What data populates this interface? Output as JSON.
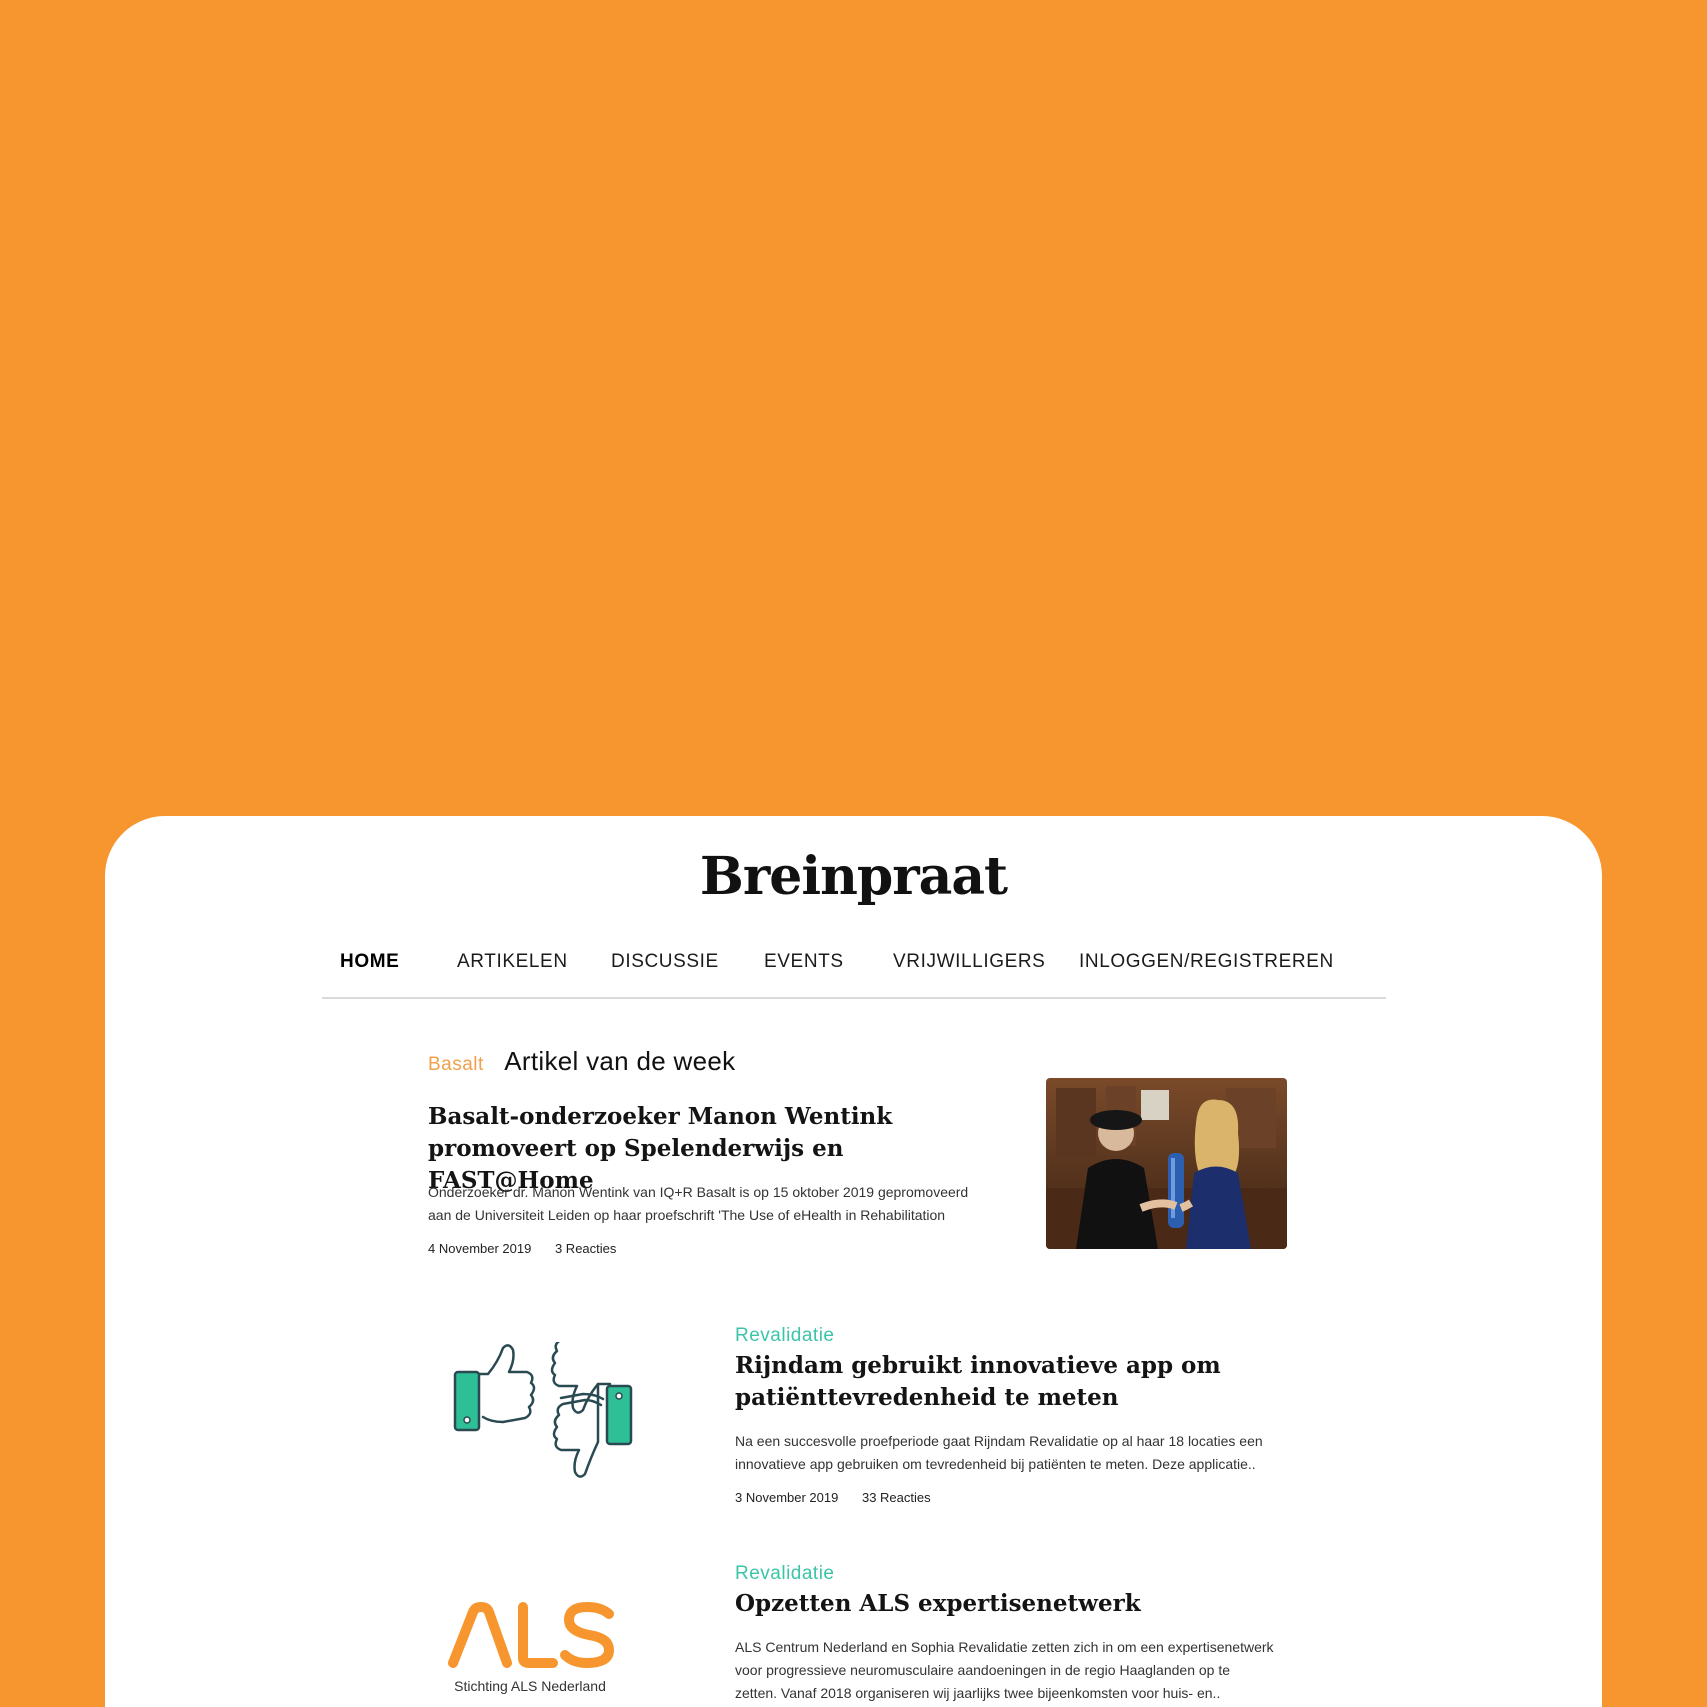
{
  "site": {
    "brand": "Breinpraat"
  },
  "nav": {
    "items": [
      {
        "label": "HOME"
      },
      {
        "label": "ARTIKELEN"
      },
      {
        "label": "DISCUSSIE"
      },
      {
        "label": "EVENTS"
      },
      {
        "label": "VRIJWILLIGERS"
      },
      {
        "label": "INLOGGEN/REGISTREREN"
      }
    ]
  },
  "featured": {
    "category": "Basalt",
    "section_title": "Artikel van de week",
    "title_line1": "Basalt-onderzoeker Manon Wentink",
    "title_line2": "promoveert op Spelenderwijs en FAST@Home",
    "excerpt_line1": "Onderzoeker dr. Manon Wentink van IQ+R Basalt is op 15 oktober 2019 gepromoveerd",
    "excerpt_line2": "aan de Universiteit Leiden op haar proefschrift 'The Use of eHealth in Rehabilitation",
    "date": "4 November 2019",
    "reactions": "3 Reacties"
  },
  "articles": [
    {
      "category": "Revalidatie",
      "title_line1": "Rijndam gebruikt innovatieve app om",
      "title_line2": "patiënttevredenheid te meten",
      "excerpt_line1": "Na een succesvolle proefperiode gaat Rijndam Revalidatie op al haar 18 locaties een",
      "excerpt_line2": "innovatieve app gebruiken om tevredenheid bij patiënten te meten. Deze applicatie..",
      "date": "3 November 2019",
      "reactions": "33 Reacties",
      "image_icon": "thumbs-up-down-icon"
    },
    {
      "category": "Revalidatie",
      "title_line1": "Opzetten ALS expertisenetwerk",
      "excerpt_line1": "ALS Centrum Nederland en Sophia Revalidatie zetten zich in om een expertisenetwerk",
      "excerpt_line2": "voor progressieve neuromusculaire aandoeningen in de regio Haaglanden op te",
      "excerpt_line3": "zetten. Vanaf 2018 organiseren wij jaarlijks twee bijeenkomsten voor huis- en..",
      "logo_text": "ALS",
      "logo_subtitle": "Stichting ALS Nederland"
    }
  ],
  "colors": {
    "background": "#f7962f",
    "category_orange": "#f0a04a",
    "category_green": "#3cc4a8",
    "icon_teal": "#2fbf97",
    "icon_outline": "#2a4a52"
  }
}
